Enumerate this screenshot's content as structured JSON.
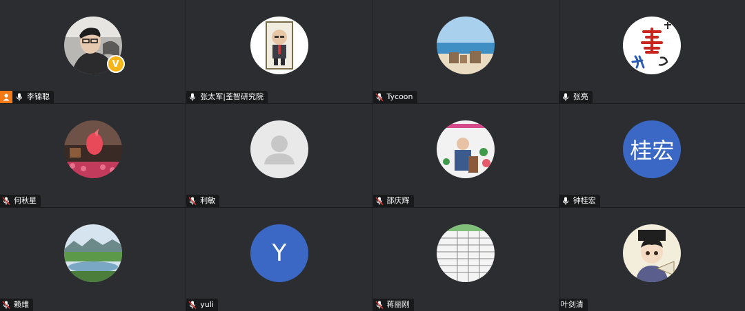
{
  "participants": [
    {
      "name": "李锦聪",
      "host": true,
      "verified": true,
      "muted": false,
      "avatar": "photo",
      "avatar_desc_icon": "person-photo-icon"
    },
    {
      "name": "张太军|荃智研究院",
      "host": false,
      "muted": false,
      "avatar": "photo",
      "avatar_desc_icon": "caricature-photo-icon"
    },
    {
      "name": "Tycoon",
      "host": false,
      "muted": true,
      "avatar": "photo",
      "avatar_desc_icon": "beach-photo-icon"
    },
    {
      "name": "张亮",
      "host": false,
      "muted": false,
      "avatar": "photo",
      "avatar_desc_icon": "calligraphy-photo-icon"
    },
    {
      "name": "何秋星",
      "host": false,
      "muted": true,
      "avatar": "photo",
      "avatar_desc_icon": "fish-photo-icon"
    },
    {
      "name": "利敏",
      "host": false,
      "muted": true,
      "avatar": "default",
      "avatar_desc_icon": "default-user-icon"
    },
    {
      "name": "邵庆辉",
      "host": false,
      "muted": true,
      "avatar": "photo",
      "avatar_desc_icon": "speaker-photo-icon"
    },
    {
      "name": "钟桂宏",
      "host": false,
      "muted": false,
      "avatar": "initials",
      "initials": "桂宏"
    },
    {
      "name": "赖维",
      "host": false,
      "muted": true,
      "avatar": "photo",
      "avatar_desc_icon": "landscape-photo-icon"
    },
    {
      "name": "yuli",
      "host": false,
      "muted": true,
      "avatar": "initials",
      "initials": "Y"
    },
    {
      "name": "蒋丽刚",
      "host": false,
      "muted": true,
      "avatar": "photo",
      "avatar_desc_icon": "document-photo-icon"
    },
    {
      "name": "叶剑清",
      "host": false,
      "muted": null,
      "avatar": "photo",
      "avatar_desc_icon": "cartoon-scholar-icon"
    }
  ],
  "verified_badge_text": "V",
  "colors": {
    "tile_bg": "#2c2d30",
    "label_bg": "#18191b",
    "host_badge": "#f47a18",
    "muted_red": "#e53935",
    "initials_bg": "#3a68c4"
  }
}
